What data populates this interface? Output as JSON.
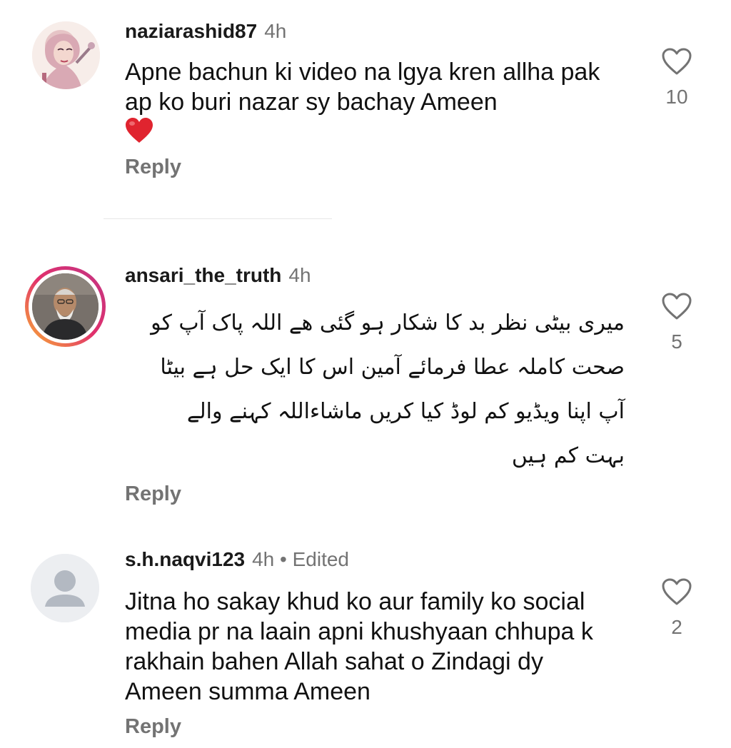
{
  "comments": [
    {
      "username": "naziarashid87",
      "time": "4h",
      "text": "Apne bachun ki video na lgya kren allha pak ap ko buri nazar sy bachay Ameen",
      "emoji_icon": "red-heart-emoji",
      "likes": "10",
      "reply_label": "Reply"
    },
    {
      "username": "ansari_the_truth",
      "time": "4h",
      "lines": [
        "میری بیٹی نظر بد کا شکار ہو گئی ھے اللہ پاک آپ کو",
        "صحت کاملہ عطا فرمائے آمین اس کا ایک حل ہے بیٹا",
        "آپ اپنا ویڈیو کم لوڈ کیا کریں ماشاءاللہ کہنے والے",
        "بہت کم ہیں"
      ],
      "likes": "5",
      "reply_label": "Reply"
    },
    {
      "username": "s.h.naqvi123",
      "time": "4h",
      "edited": "• Edited",
      "text": "Jitna ho sakay khud ko aur family ko social media pr na laain apni khushyaan chhupa k rakhain bahen Allah sahat o Zindagi dy Ameen summa Ameen",
      "likes": "2",
      "reply_label": "Reply"
    }
  ],
  "colors": {
    "text": "#111111",
    "muted": "#737373",
    "story_ring_start": "#f9b233",
    "story_ring_end": "#c13584",
    "heart": "#e0242f"
  }
}
